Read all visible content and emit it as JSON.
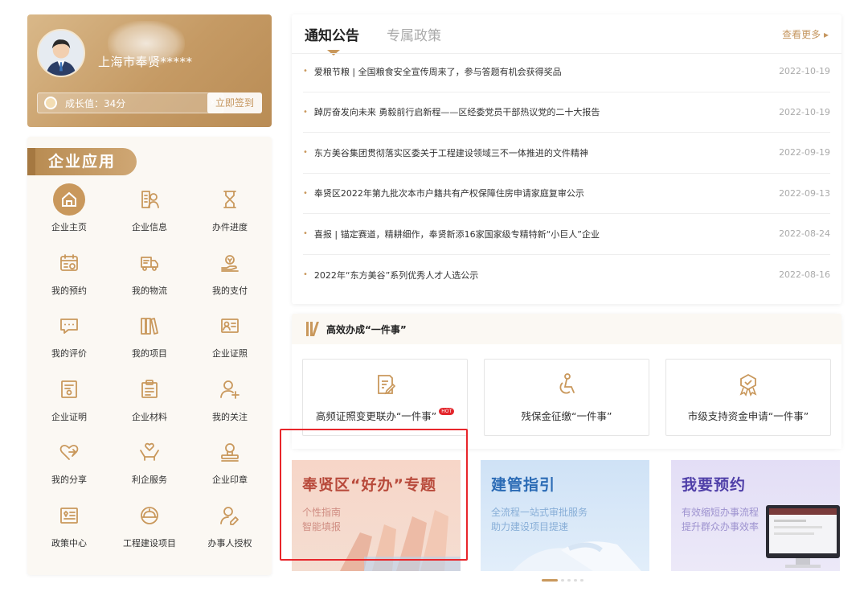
{
  "user": {
    "company": "上海市奉贤*****",
    "growth_label": "成长值：34分",
    "growth_arrow": "›",
    "sign_button": "立即签到"
  },
  "apps": {
    "title": "企业应用",
    "items": [
      {
        "label": "企业主页",
        "icon": "home-icon"
      },
      {
        "label": "企业信息",
        "icon": "enterprise-info-icon"
      },
      {
        "label": "办件进度",
        "icon": "hourglass-icon"
      },
      {
        "label": "我的预约",
        "icon": "calendar-icon"
      },
      {
        "label": "我的物流",
        "icon": "truck-icon"
      },
      {
        "label": "我的支付",
        "icon": "payment-icon"
      },
      {
        "label": "我的评价",
        "icon": "comment-icon"
      },
      {
        "label": "我的项目",
        "icon": "books-icon"
      },
      {
        "label": "企业证照",
        "icon": "license-icon"
      },
      {
        "label": "企业证明",
        "icon": "certificate-icon"
      },
      {
        "label": "企业材料",
        "icon": "clipboard-icon"
      },
      {
        "label": "我的关注",
        "icon": "user-follow-icon"
      },
      {
        "label": "我的分享",
        "icon": "heart-share-icon"
      },
      {
        "label": "利企服务",
        "icon": "hands-heart-icon"
      },
      {
        "label": "企业印章",
        "icon": "seal-icon"
      },
      {
        "label": "政策中心",
        "icon": "policy-book-icon"
      },
      {
        "label": "工程建设项目",
        "icon": "helmet-icon"
      },
      {
        "label": "办事人授权",
        "icon": "user-auth-icon"
      }
    ]
  },
  "notice": {
    "tabs": [
      "通知公告",
      "专属政策"
    ],
    "more": "查看更多 ▸",
    "items": [
      {
        "title": "爱粮节粮 | 全国粮食安全宣传周来了，参与答题有机会获得奖品",
        "date": "2022-10-19"
      },
      {
        "title": "踔厉奋发向未来 勇毅前行启新程——区经委党员干部热议党的二十大报告",
        "date": "2022-10-19"
      },
      {
        "title": "东方美谷集团贯彻落实区委关于工程建设领域三不一体推进的文件精神",
        "date": "2022-09-19"
      },
      {
        "title": "奉贤区2022年第九批次本市户籍共有产权保障住房申请家庭复审公示",
        "date": "2022-09-13"
      },
      {
        "title": "喜报 | 锚定赛道，精耕细作，奉贤新添16家国家级专精特新“小巨人”企业",
        "date": "2022-08-24"
      },
      {
        "title": "2022年“东方美谷”系列优秀人才人选公示",
        "date": "2022-08-16"
      }
    ]
  },
  "onething": {
    "title": "高效办成“一件事”",
    "cards": [
      {
        "label": "高频证照变更联办“一件事”",
        "hot": "HOT",
        "icon": "edit-doc-icon"
      },
      {
        "label": "残保金征缴“一件事”",
        "icon": "disabled-person-icon"
      },
      {
        "label": "市级支持资金申请“一件事”",
        "icon": "award-icon"
      }
    ]
  },
  "banners": [
    {
      "title": "奉贤区“好办”专题",
      "line1": "个性指南",
      "line2": "智能填报"
    },
    {
      "title": "建管指引",
      "line1": "全流程一站式审批服务",
      "line2": "助力建设项目提速"
    },
    {
      "title": "我要预约",
      "line1": "有效缩短办事流程",
      "line2": "提升群众办事效率"
    }
  ],
  "colors": {
    "accent": "#c9985c",
    "highlight": "#e8262b"
  }
}
